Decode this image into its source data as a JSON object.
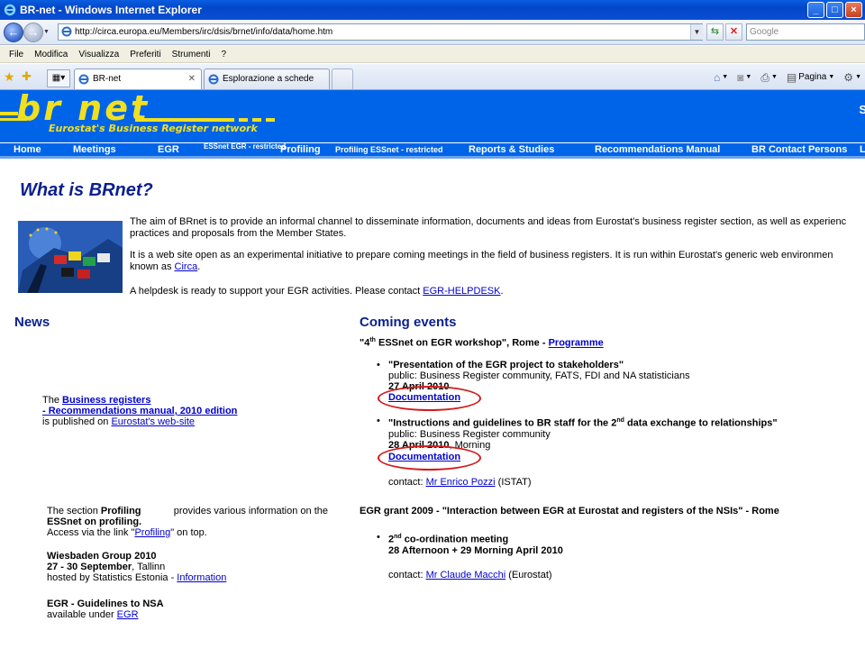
{
  "window": {
    "title": "BR-net - Windows Internet Explorer"
  },
  "address": {
    "url": "http://circa.europa.eu/Members/irc/dsis/brnet/info/data/home.htm",
    "search_placeholder": "Google"
  },
  "menu": [
    "File",
    "Modifica",
    "Visualizza",
    "Preferiti",
    "Strumenti",
    "?"
  ],
  "tabs": [
    {
      "label": "BR-net",
      "active": true
    },
    {
      "label": "Esplorazione a schede",
      "active": false
    }
  ],
  "command_bar": {
    "page_label": "Pagina",
    "tools_icon": "gear-icon"
  },
  "banner": {
    "logo": "br net",
    "tagline": "Eurostat's Business Register network",
    "right_fragment": "S"
  },
  "nav": [
    "Home",
    "Meetings",
    "EGR",
    "ESSnet EGR - restricted",
    "Profiling",
    "Profiling ESSnet - restricted",
    "Reports & Studies",
    "Recommendations Manual",
    "BR Contact Persons",
    "L"
  ],
  "intro": {
    "heading": "What is BRnet?",
    "p1_line1": "The aim of BRnet is to provide an informal channel to disseminate information, documents and ideas from Eurostat's business register section, as well as experienc",
    "p1_line2": "practices and proposals from the Member States.",
    "p2_line1": "It is a web site open as an experimental initiative to prepare coming meetings in the field of business registers. It is run within Eurostat's generic web environmen",
    "p2_line2_prefix": "known as ",
    "p2_link": "Circa",
    "p2_suffix": ".",
    "p3_prefix": "A helpdesk is ready to support your EGR activities. Please contact ",
    "p3_link": "EGR-HELPDESK",
    "p3_suffix": "."
  },
  "news": {
    "heading": "News",
    "item1": {
      "prefix": "The ",
      "link1": "Business registers",
      "link2": "- Recommendations manual, 2010 edition",
      "line3_prefix": "is published on ",
      "link3": "Eurostat's web-site"
    },
    "item2": {
      "l1_a": "The section ",
      "l1_b": "Profiling",
      "l1_c": " provides various information on the",
      "l2": "ESSnet on profiling.",
      "l3_prefix": "Access via the link \"",
      "l3_link": "Profiling",
      "l3_suffix": "\" on top."
    },
    "item3": {
      "title": "Wiesbaden Group 2010",
      "date": "27 - 30 September",
      "place": ", Tallinn",
      "host_prefix": "hosted by Statistics Estonia - ",
      "host_link": "Information"
    },
    "item4": {
      "title": "EGR - Guidelines to NSA",
      "prefix": "available under ",
      "link": "EGR"
    }
  },
  "events": {
    "heading": "Coming events",
    "workshop": {
      "pre": "\"4",
      "sup": "th",
      "post": " ESSnet on EGR workshop\", Rome - ",
      "link": "Programme"
    },
    "e1": {
      "title": "\"Presentation of the EGR project to stakeholders\"",
      "audience": "public: Business Register community, FATS, FDI and NA statisticians",
      "date": "27 April 2010",
      "link": "Documentation"
    },
    "e2": {
      "title_pre": "\"Instructions and guidelines to BR staff for the 2",
      "title_sup": "nd",
      "title_post": " data exchange to relationships\"",
      "audience": "public: Business Register community",
      "date_bold": "28 April 2010",
      "date_rest": ", Morning",
      "link": "Documentation"
    },
    "contact1": {
      "prefix": "contact: ",
      "link": "Mr Enrico Pozzi",
      "suffix": " (ISTAT)"
    },
    "grant": "EGR grant 2009 - \"Interaction between EGR at Eurostat and registers of the NSIs\" - Rome",
    "e3": {
      "pre": "2",
      "sup": "nd",
      "post": " co-ordination meeting",
      "date": "28 Afternoon + 29 Morning April 2010"
    },
    "contact2": {
      "prefix": "contact: ",
      "link": "Mr Claude Macchi",
      "suffix": " (Eurostat)"
    }
  },
  "colors": {
    "banner_blue": "#0064e8",
    "logo_yellow": "#f0e020",
    "heading_navy": "#0b1f8f",
    "annotation_red": "#d21b1b"
  }
}
